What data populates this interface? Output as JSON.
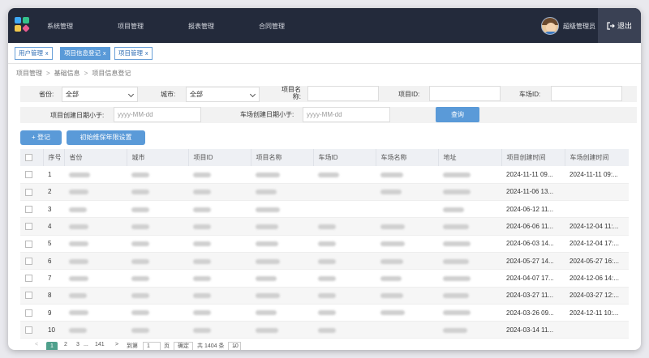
{
  "nav": {
    "items": [
      "系统管理",
      "项目管理",
      "报表管理",
      "合同管理"
    ],
    "user_name": "超级管理员",
    "logout_label": "退出",
    "logout_icon": "logout-icon",
    "logo_colors": [
      "#3fa9f5",
      "#34c28b",
      "#f2c94c",
      "#e85a8f"
    ]
  },
  "tabs": [
    {
      "label": "用户管理",
      "close": "x",
      "active": false
    },
    {
      "label": "项目信息登记",
      "close": "x",
      "active": true
    },
    {
      "label": "项目管理",
      "close": "x",
      "active": false
    }
  ],
  "breadcrumb": [
    "项目管理",
    "基础信息",
    "项目信息登记"
  ],
  "breadcrumb_sep": ">",
  "filters": {
    "province_label": "省份:",
    "province_value": "全部",
    "city_label": "城市:",
    "city_value": "全部",
    "project_name_label": "项目名称:",
    "project_name_value": "",
    "project_id_label": "项目ID:",
    "project_id_value": "",
    "site_id_label": "车场ID:",
    "site_id_value": "",
    "project_date_label": "项目创建日期小于:",
    "project_date_placeholder": "yyyy-MM-dd",
    "site_date_label": "车场创建日期小于:",
    "site_date_placeholder": "yyyy-MM-dd",
    "query_label": "查询"
  },
  "actions": {
    "add_label": "+ 登记",
    "init_label": "初始维保年限设置"
  },
  "table": {
    "columns": [
      "序号",
      "省份",
      "城市",
      "项目ID",
      "项目名称",
      "车场ID",
      "车场名称",
      "地址",
      "项目创建时间",
      "车场创建时间"
    ],
    "rows": [
      {
        "no": "1",
        "project_time": "2024-11-11 09...",
        "site_time": "2024-11-11 09:..."
      },
      {
        "no": "2",
        "project_time": "2024-11-06 13...",
        "site_time": ""
      },
      {
        "no": "3",
        "project_time": "2024-06-12 11...",
        "site_time": ""
      },
      {
        "no": "4",
        "project_time": "2024-06-06 11...",
        "site_time": "2024-12-04 11:..."
      },
      {
        "no": "5",
        "project_time": "2024-06-03 14...",
        "site_time": "2024-12-04 17:..."
      },
      {
        "no": "6",
        "project_time": "2024-05-27 14...",
        "site_time": "2024-05-27 16:..."
      },
      {
        "no": "7",
        "project_time": "2024-04-07 17...",
        "site_time": "2024-12-06 14:..."
      },
      {
        "no": "8",
        "project_time": "2024-03-27 11...",
        "site_time": "2024-03-27 12:..."
      },
      {
        "no": "9",
        "project_time": "2024-03-26 09...",
        "site_time": "2024-12-11 10:..."
      },
      {
        "no": "10",
        "project_time": "2024-03-14 11...",
        "site_time": ""
      }
    ]
  },
  "pager": {
    "prev": "<",
    "pages": [
      "1",
      "2",
      "3",
      "...",
      "141"
    ],
    "next": ">",
    "goto_label": "到第",
    "goto_value": "1",
    "page_unit": "页",
    "confirm": "确定",
    "total": "共 1404 条",
    "page_size": "10 条/页"
  }
}
